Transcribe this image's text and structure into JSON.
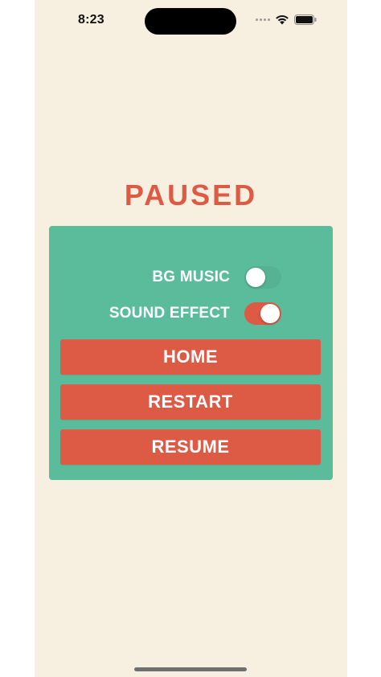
{
  "status_bar": {
    "time": "8:23",
    "icons": [
      "cellular-signal-icon",
      "wifi-icon",
      "battery-icon"
    ]
  },
  "pause_screen": {
    "title": "PAUSED",
    "settings": [
      {
        "label": "BG MUSIC",
        "enabled": false
      },
      {
        "label": "SOUND EFFECT",
        "enabled": true
      }
    ],
    "buttons": {
      "home": "HOME",
      "restart": "RESTART",
      "resume": "RESUME"
    }
  },
  "colors": {
    "background": "#f7f0e1",
    "accent": "#dd5a45",
    "panel": "#5bbc9c",
    "text_on_accent": "#ffffff"
  }
}
